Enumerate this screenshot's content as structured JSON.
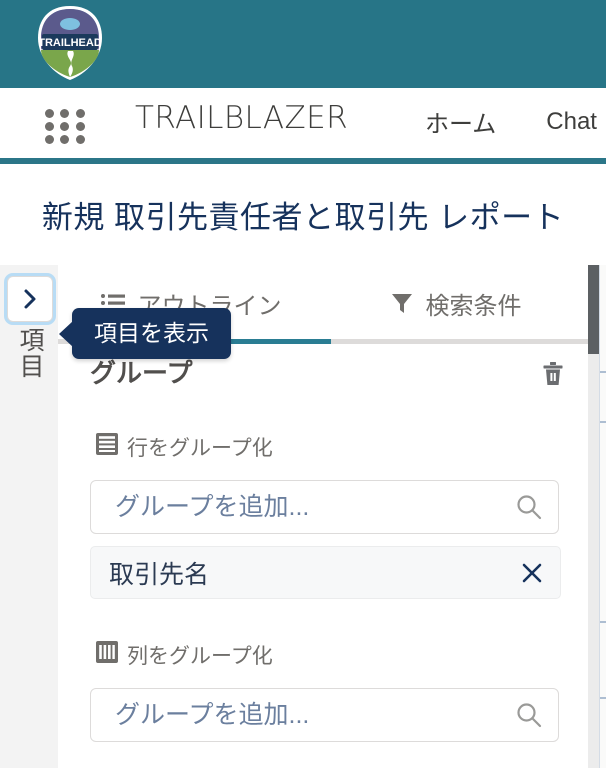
{
  "theme": {
    "teal_bar": "#277587",
    "nav_underline": "#2b7688",
    "active_tab": "#2a7d93",
    "tooltip_bg": "#16325c",
    "title_color": "#16325c",
    "placeholder_color": "#6b7f9e"
  },
  "header": {
    "logo_name": "trailhead-logo",
    "logo_text": "TRAILHEAD",
    "app_launcher_icon": "app-launcher-grid-icon",
    "app_name": "TRAILBLAZER",
    "nav_links": [
      {
        "label": "ホーム"
      },
      {
        "label": "Chat"
      }
    ]
  },
  "page": {
    "title": "新規 取引先責任者と取引先 レポート"
  },
  "left_rail": {
    "expand_button_icon": "chevron-right-icon",
    "vertical_label": "項目"
  },
  "tooltip": {
    "text": "項目を表示"
  },
  "tabs": [
    {
      "label": "アウトライン",
      "icon": "outline-list-icon",
      "active": true
    },
    {
      "label": "検索条件",
      "icon": "filter-funnel-icon",
      "active": false
    }
  ],
  "group_section": {
    "title": "グループ",
    "delete_icon": "trash-icon",
    "rows": {
      "icon": "rows-icon",
      "label": "行をグループ化",
      "search_placeholder": "グループを追加...",
      "search_icon": "search-icon",
      "chips": [
        {
          "label": "取引先名",
          "remove_icon": "close-icon"
        }
      ]
    },
    "columns": {
      "icon": "columns-icon",
      "label": "列をグループ化",
      "search_placeholder": "グループを追加...",
      "search_icon": "search-icon"
    }
  },
  "scrollbar": {
    "name": "panel-vertical-scrollbar"
  }
}
